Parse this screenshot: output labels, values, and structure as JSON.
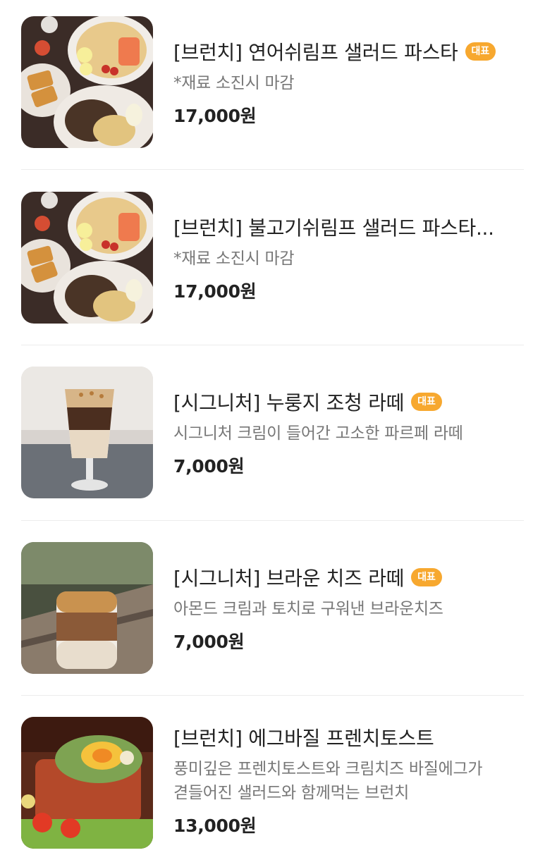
{
  "menu": {
    "items": [
      {
        "title": "[브런치] 연어쉬림프 샐러드 파스타",
        "badge": "대표",
        "description": "*재료 소진시 마감",
        "price": "17,000원",
        "image_icon": "salmon-shrimp-salad-pasta-photo"
      },
      {
        "title": "[브런치] 불고기쉬림프 샐러드 파스타...",
        "badge": "",
        "description": "*재료 소진시 마감",
        "price": "17,000원",
        "image_icon": "bulgogi-shrimp-salad-pasta-photo"
      },
      {
        "title": "[시그니처] 누룽지 조청 라떼",
        "badge": "대표",
        "description": "시그니처 크림이 들어간 고소한 파르페 라떼",
        "price": "7,000원",
        "image_icon": "nurungji-latte-photo"
      },
      {
        "title": "[시그니처] 브라운 치즈 라떼",
        "badge": "대표",
        "description": "아몬드 크림과 토치로 구워낸 브라운치즈",
        "price": "7,000원",
        "image_icon": "brown-cheese-latte-photo"
      },
      {
        "title": "[브런치] 에그바질 프렌치토스트",
        "badge": "",
        "description": "풍미깊은 프렌치토스트와 크림치즈 바질에그가\n겯들어진 샐러드와 함께먹는 브런치",
        "price": "13,000원",
        "image_icon": "egg-basil-french-toast-photo"
      }
    ],
    "colors": {
      "badge": "#f7a82f",
      "price": "#222222",
      "description": "#777777",
      "divider": "#ececec"
    }
  }
}
